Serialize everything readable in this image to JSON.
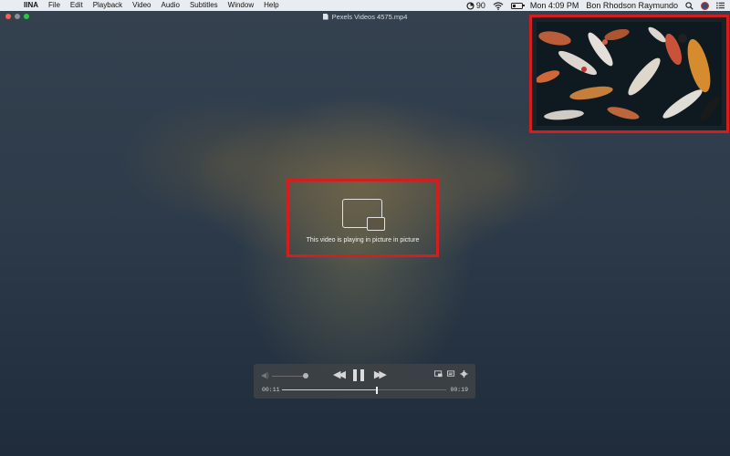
{
  "menubar": {
    "app_name": "IINA",
    "menus": [
      "File",
      "Edit",
      "Playback",
      "Video",
      "Audio",
      "Subtitles",
      "Window",
      "Help"
    ],
    "status_number": "90",
    "clock": "Mon 4:09 PM",
    "user": "Bon Rhodson Raymundo"
  },
  "window": {
    "title": "Pexels Videos 4575.mp4"
  },
  "pip": {
    "message": "This video is playing in picture in picture"
  },
  "controls": {
    "current_time": "00:11",
    "duration": "00:19",
    "volume": 0.9,
    "progress": 0.58
  },
  "colors": {
    "highlight": "#d21e1e",
    "background": "#263343"
  }
}
